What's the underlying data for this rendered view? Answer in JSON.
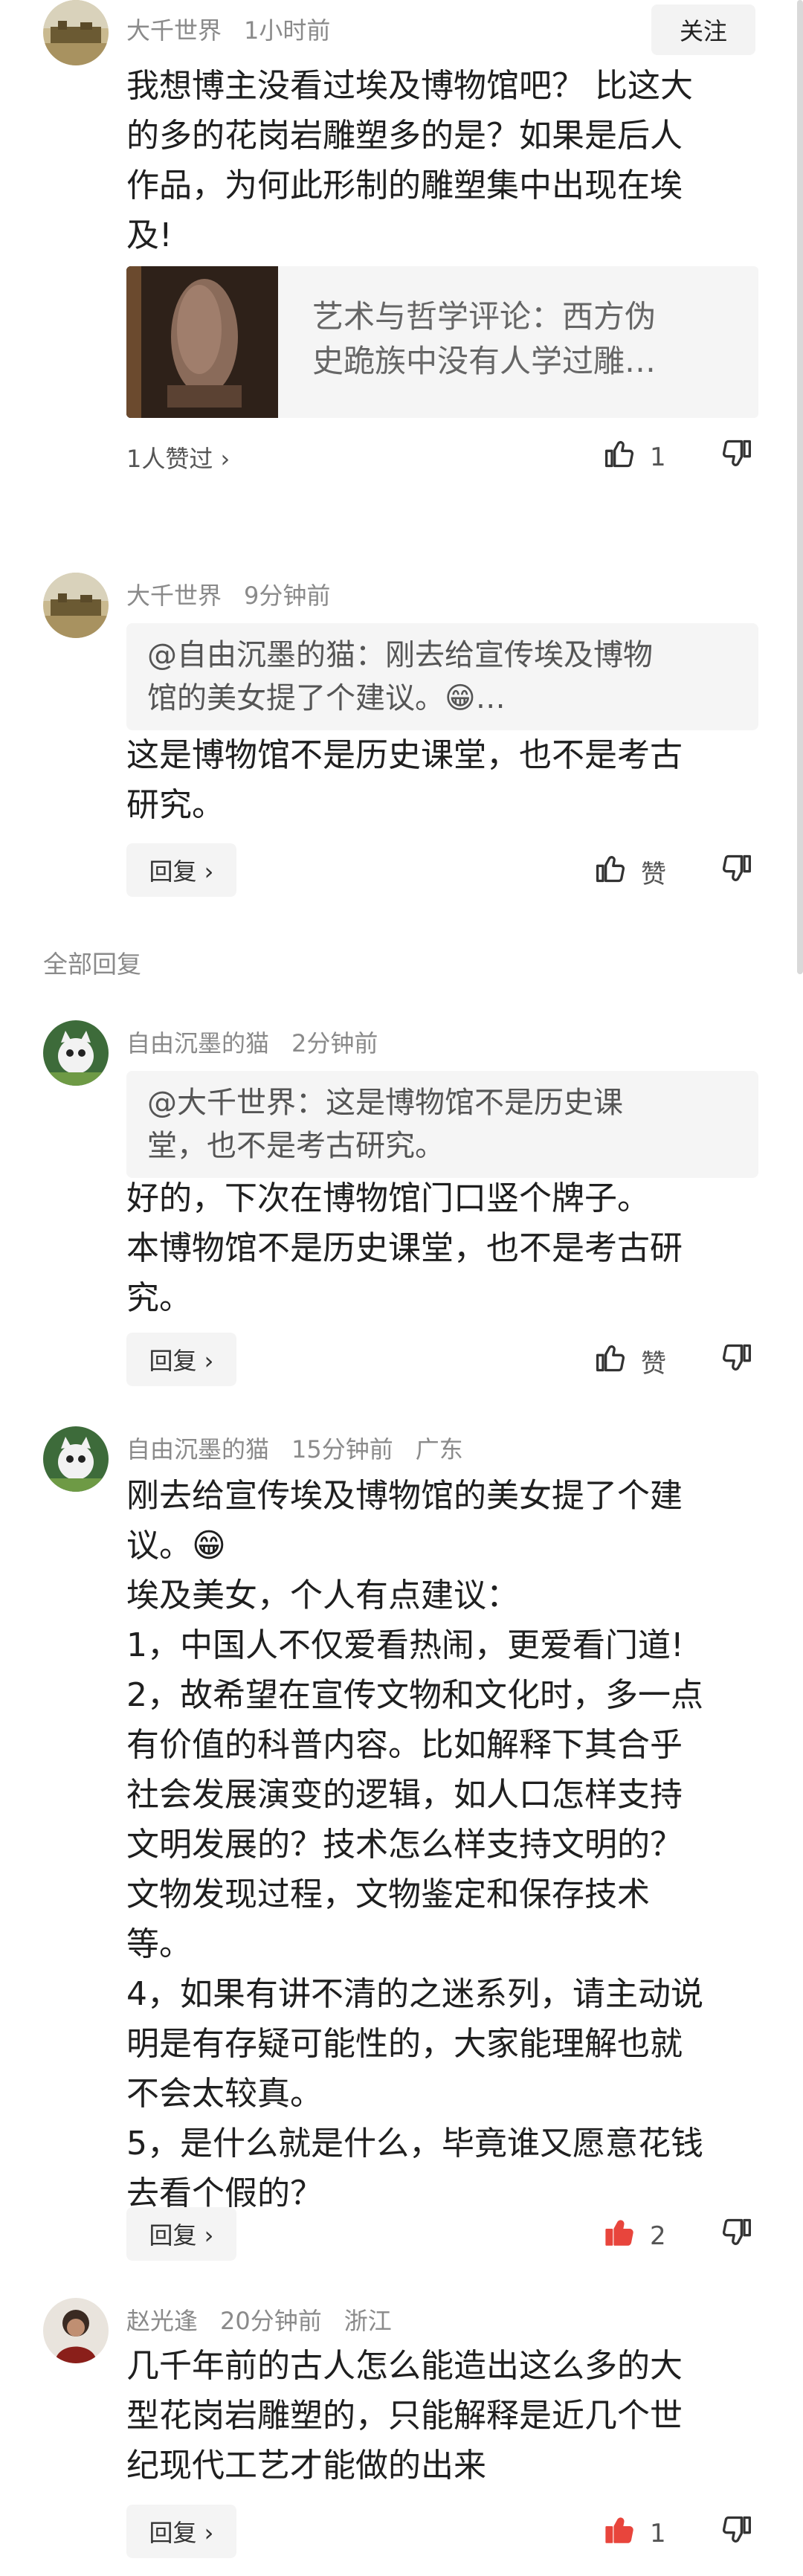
{
  "comments": [
    {
      "user": "大千世界",
      "time": "1小时前",
      "follow": "关注",
      "lines": [
        "我想博主没看过埃及博物馆吧？ 比这大",
        "的多的花岗岩雕塑多的是？如果是后人",
        "作品，为何此形制的雕塑集中出现在埃",
        "及!"
      ],
      "card": {
        "lines": [
          "艺术与哲学评论：西方伪",
          "史跪族中没有人学过雕…"
        ]
      },
      "likers": "1人赞过 ›",
      "like": "1"
    },
    {
      "user": "大千世界",
      "time": "9分钟前",
      "quote": [
        "@自由沉墨的猫：刚去给宣传埃及博物",
        "馆的美女提了个建议。😁…"
      ],
      "lines": [
        "这是博物馆不是历史课堂，也不是考古",
        "研究。"
      ],
      "reply": "回复 ›",
      "like": "赞"
    },
    {
      "user": "自由沉墨的猫",
      "time": "2分钟前",
      "quote": [
        "@大千世界：这是博物馆不是历史课",
        "堂，也不是考古研究。"
      ],
      "lines": [
        "好的，下次在博物馆门口竖个牌子。",
        "本博物馆不是历史课堂，也不是考古研",
        "究。"
      ],
      "reply": "回复 ›",
      "like": "赞"
    },
    {
      "user": "自由沉墨的猫",
      "time": "15分钟前",
      "location": "广东",
      "lines": [
        "刚去给宣传埃及博物馆的美女提了个建",
        "议。😁",
        "埃及美女，个人有点建议：",
        "1，中国人不仅爱看热闹，更爱看门道!",
        "2，故希望在宣传文物和文化时，多一点",
        "有价值的科普内容。比如解释下其合乎",
        "社会发展演变的逻辑，如人口怎样支持",
        "文明发展的？技术怎么样支持文明的？",
        "文物发现过程，文物鉴定和保存技术",
        "等。",
        "4，如果有讲不清的之迷系列，请主动说",
        "明是有存疑可能性的，大家能理解也就",
        "不会太较真。",
        "5，是什么就是什么，毕竟谁又愿意花钱",
        "去看个假的？"
      ],
      "reply": "回复 ›",
      "like": "2"
    },
    {
      "user": "赵光逢",
      "time": "20分钟前",
      "location": "浙江",
      "lines": [
        "几千年前的古人怎么能造出这么多的大",
        "型花岗岩雕塑的，只能解释是近几个世",
        "纪现代工艺才能做的出来"
      ],
      "reply": "回复 ›",
      "like": "1"
    }
  ],
  "section_label": "全部回复",
  "colors": {
    "liked": "#e8453c",
    "meta": "#8a8a8a"
  }
}
